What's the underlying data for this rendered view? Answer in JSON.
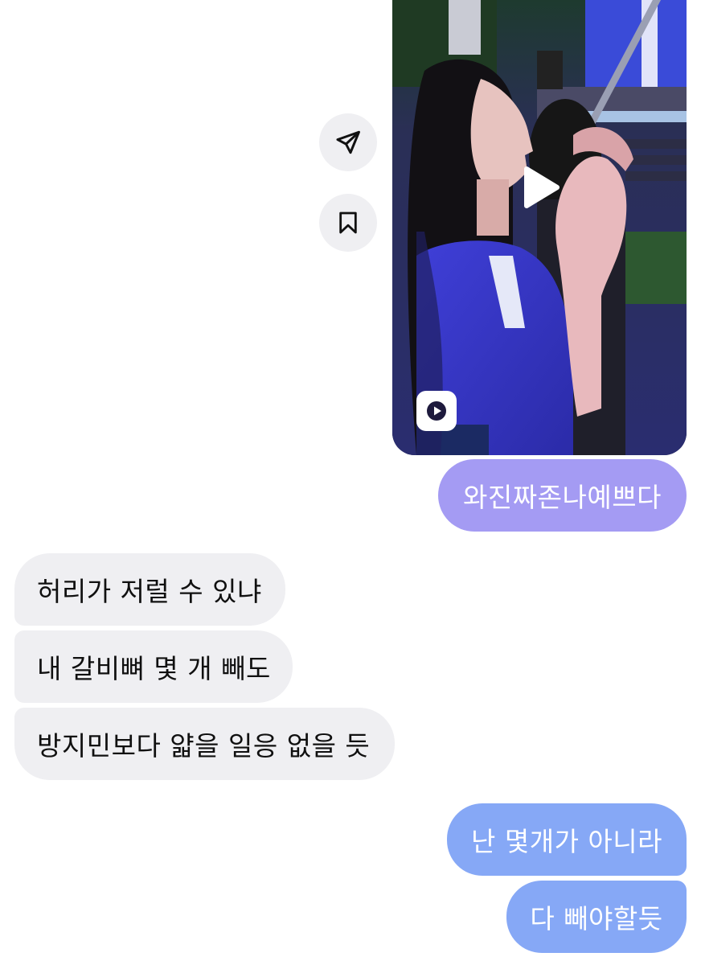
{
  "conversation": {
    "shared_media": {
      "type": "reel",
      "actions": [
        {
          "icon": "send-icon"
        },
        {
          "icon": "bookmark-icon"
        }
      ],
      "center_icon": "play-icon",
      "badge_icon": "reels-icon"
    },
    "messages": [
      {
        "sender": "me",
        "text": "와진짜존나예쁘다"
      },
      {
        "sender": "other",
        "text": "허리가 저럴 수 있냐"
      },
      {
        "sender": "other",
        "text": "내 갈비뼈 몇 개 빼도"
      },
      {
        "sender": "other",
        "text": "방지민보다 얇을 일응 없을 듯"
      },
      {
        "sender": "me",
        "text": "난 몇개가 아니라"
      },
      {
        "sender": "me",
        "text": "다 빼야할듯"
      }
    ]
  },
  "colors": {
    "incoming_bubble": "#efeff2",
    "outgoing_purple": "#a49bf3",
    "outgoing_blue": "#86a8f6",
    "side_button": "#efeff2"
  }
}
